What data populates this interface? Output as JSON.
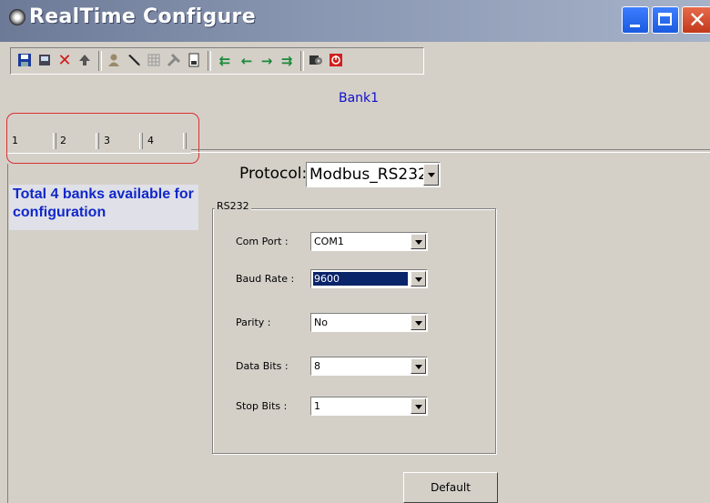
{
  "window": {
    "title": "RealTime Configure",
    "controls": {
      "minimize": "minimize-icon",
      "maximize": "maximize-icon",
      "close": "close-icon"
    }
  },
  "toolbar": {
    "icons": [
      "save-icon",
      "print-icon",
      "delete-icon",
      "upload-icon",
      "user-icon",
      "pencil-icon",
      "grid-icon",
      "tools-icon",
      "document-icon",
      "first-icon",
      "previous-icon",
      "next-icon",
      "last-icon",
      "settings-icon",
      "power-icon"
    ]
  },
  "bank": {
    "title": "Bank1",
    "tabs": [
      "1",
      "2",
      "3",
      "4"
    ],
    "info": "Total 4 banks available for configuration"
  },
  "protocol": {
    "label": "Protocol:",
    "value": "Modbus_RS232"
  },
  "rs232": {
    "title": "RS232",
    "com_port": {
      "label": "Com Port :",
      "value": "COM1"
    },
    "baud_rate": {
      "label": "Baud Rate :",
      "value": "9600"
    },
    "parity": {
      "label": "Parity :",
      "value": "No"
    },
    "data_bits": {
      "label": "Data Bits :",
      "value": "8"
    },
    "stop_bits": {
      "label": "Stop Bits :",
      "value": "1"
    }
  },
  "buttons": {
    "default": "Default"
  },
  "colors": {
    "title_bar": "#8a97b2",
    "bank_title": "#1010cc",
    "info_text": "#1028c8",
    "highlight_outline": "#d93030",
    "selection": "#0a246a"
  }
}
